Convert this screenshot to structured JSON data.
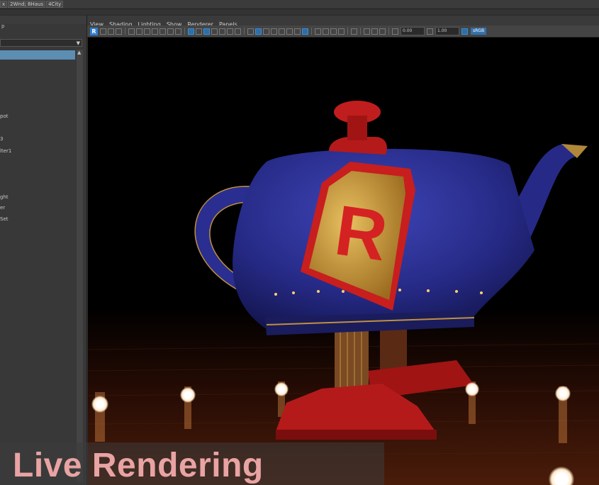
{
  "top_strip": {
    "fields": [
      "x",
      "2Wnd; 8Haus",
      "4City"
    ]
  },
  "outliner": {
    "header": "p",
    "rows": [
      "pot",
      "3",
      "lter1",
      "ght",
      "er",
      "Set"
    ]
  },
  "viewport_panel": {
    "menu": [
      "View",
      "Shading",
      "Lighting",
      "Show",
      "Renderer",
      "Panels"
    ],
    "toolbar": {
      "render_button": "R",
      "exposure_value": "0.00",
      "gamma_value": "1.00",
      "color_space": "sRGB"
    }
  },
  "caption": "Live Rendering",
  "colors": {
    "accent": "#5c8eb4",
    "caption": "#e9a3a3",
    "teapot_body": "#2a2b8c",
    "teapot_red": "#c81e1e",
    "floor": "#3a1508"
  }
}
